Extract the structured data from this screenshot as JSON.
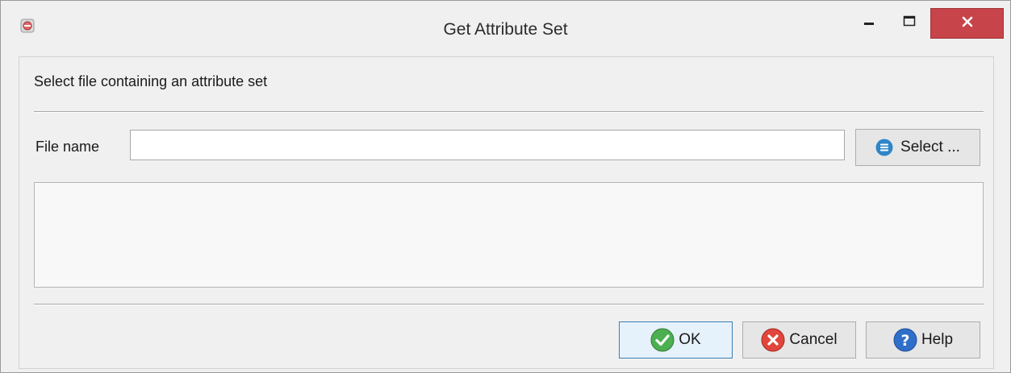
{
  "window": {
    "title": "Get Attribute Set",
    "controls": {
      "minimize_icon": "minimize-icon",
      "maximize_icon": "maximize-icon",
      "close_icon": "close-icon",
      "close_color": "#c7444a"
    }
  },
  "dialog": {
    "prompt": "Select file containing an attribute set",
    "file_name_label": "File name",
    "file_name_value": "",
    "select_button": {
      "label": "Select ...",
      "icon": "list-icon",
      "icon_color": "#2f86c8"
    },
    "info_text": ""
  },
  "footer": {
    "ok_button": {
      "label": "OK",
      "icon": "check-icon",
      "icon_color": "#4caf50"
    },
    "cancel_button": {
      "label": "Cancel",
      "icon": "cancel-x-icon",
      "icon_color": "#e0463c"
    },
    "help_button": {
      "label": "Help",
      "icon": "question-icon",
      "icon_color": "#2f6fc9"
    }
  }
}
